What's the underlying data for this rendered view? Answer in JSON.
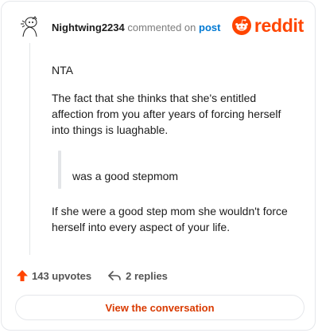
{
  "header": {
    "username": "Nightwing2234",
    "commented_text": "commented on",
    "post_link": "post"
  },
  "brand": {
    "logo_text": "reddit",
    "accent": "#ff4500"
  },
  "comment": {
    "paragraph_1": "NTA",
    "paragraph_2": "The fact that she thinks that she's entitled affection from you after years of forcing herself into things is luaghable.",
    "quote": "was a good stepmom",
    "paragraph_3": "If she were a good step mom she wouldn't force herself into every aspect of your life."
  },
  "footer": {
    "upvotes": "143 upvotes",
    "replies": "2 replies",
    "upvote_icon": "upvote-arrow-icon",
    "reply_icon": "reply-arrow-icon"
  },
  "cta": {
    "label": "View the conversation"
  }
}
